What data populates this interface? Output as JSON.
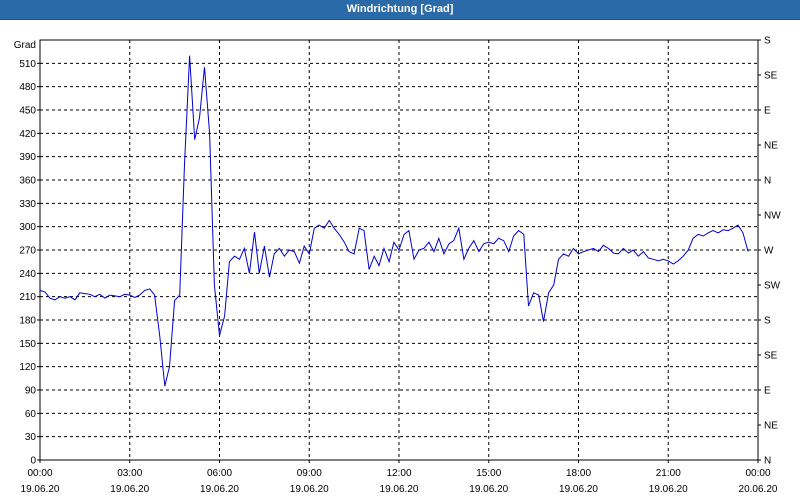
{
  "window": {
    "title": "Windrichtung [Grad]"
  },
  "chart_data": {
    "type": "line",
    "title": "Windrichtung [Grad]",
    "ylabel": "Grad",
    "xlabel": "",
    "ylim": [
      0,
      540
    ],
    "xlim": [
      0,
      24
    ],
    "grid": true,
    "yticks": [
      0,
      30,
      60,
      90,
      120,
      150,
      180,
      210,
      240,
      270,
      300,
      330,
      360,
      390,
      420,
      450,
      480,
      510
    ],
    "right_axis": {
      "ticks": [
        0,
        45,
        90,
        135,
        180,
        225,
        270,
        315,
        360,
        405,
        450,
        495,
        540
      ],
      "labels": [
        "N",
        "NE",
        "E",
        "SE",
        "S",
        "SW",
        "W",
        "NW",
        "N",
        "NE",
        "E",
        "SE",
        "S"
      ]
    },
    "xticks": [
      {
        "x": 0,
        "time": "00:00",
        "date": "19.06.20"
      },
      {
        "x": 3,
        "time": "03:00",
        "date": "19.06.20"
      },
      {
        "x": 6,
        "time": "06:00",
        "date": "19.06.20"
      },
      {
        "x": 9,
        "time": "09:00",
        "date": "19.06.20"
      },
      {
        "x": 12,
        "time": "12:00",
        "date": "19.06.20"
      },
      {
        "x": 15,
        "time": "15:00",
        "date": "19.06.20"
      },
      {
        "x": 18,
        "time": "18:00",
        "date": "19.06.20"
      },
      {
        "x": 21,
        "time": "21:00",
        "date": "19.06.20"
      },
      {
        "x": 24,
        "time": "00:00",
        "date": "20.06.20"
      }
    ],
    "series": [
      {
        "color": "#0000cc",
        "points": [
          [
            0.0,
            218
          ],
          [
            0.17,
            216
          ],
          [
            0.33,
            208
          ],
          [
            0.5,
            206
          ],
          [
            0.67,
            210
          ],
          [
            0.83,
            208
          ],
          [
            1.0,
            210
          ],
          [
            1.17,
            206
          ],
          [
            1.33,
            215
          ],
          [
            1.5,
            214
          ],
          [
            1.67,
            213
          ],
          [
            1.83,
            210
          ],
          [
            2.0,
            213
          ],
          [
            2.17,
            208
          ],
          [
            2.33,
            212
          ],
          [
            2.5,
            211
          ],
          [
            2.67,
            210
          ],
          [
            2.83,
            213
          ],
          [
            3.0,
            212
          ],
          [
            3.17,
            209
          ],
          [
            3.33,
            212
          ],
          [
            3.5,
            218
          ],
          [
            3.67,
            220
          ],
          [
            3.83,
            212
          ],
          [
            4.0,
            160
          ],
          [
            4.17,
            95
          ],
          [
            4.33,
            120
          ],
          [
            4.5,
            205
          ],
          [
            4.67,
            212
          ],
          [
            4.83,
            380
          ],
          [
            5.0,
            520
          ],
          [
            5.17,
            412
          ],
          [
            5.33,
            440
          ],
          [
            5.5,
            505
          ],
          [
            5.67,
            420
          ],
          [
            5.83,
            225
          ],
          [
            6.0,
            160
          ],
          [
            6.17,
            185
          ],
          [
            6.33,
            255
          ],
          [
            6.5,
            262
          ],
          [
            6.67,
            258
          ],
          [
            6.83,
            272
          ],
          [
            7.0,
            240
          ],
          [
            7.17,
            293
          ],
          [
            7.33,
            240
          ],
          [
            7.5,
            275
          ],
          [
            7.67,
            235
          ],
          [
            7.83,
            265
          ],
          [
            8.0,
            272
          ],
          [
            8.17,
            262
          ],
          [
            8.33,
            270
          ],
          [
            8.5,
            268
          ],
          [
            8.67,
            253
          ],
          [
            8.83,
            275
          ],
          [
            9.0,
            265
          ],
          [
            9.17,
            298
          ],
          [
            9.33,
            302
          ],
          [
            9.5,
            298
          ],
          [
            9.67,
            308
          ],
          [
            9.83,
            298
          ],
          [
            10.0,
            290
          ],
          [
            10.17,
            280
          ],
          [
            10.33,
            268
          ],
          [
            10.5,
            265
          ],
          [
            10.67,
            298
          ],
          [
            10.83,
            295
          ],
          [
            11.0,
            245
          ],
          [
            11.17,
            262
          ],
          [
            11.33,
            250
          ],
          [
            11.5,
            272
          ],
          [
            11.67,
            255
          ],
          [
            11.83,
            280
          ],
          [
            12.0,
            270
          ],
          [
            12.17,
            290
          ],
          [
            12.33,
            295
          ],
          [
            12.5,
            258
          ],
          [
            12.67,
            270
          ],
          [
            12.83,
            272
          ],
          [
            13.0,
            280
          ],
          [
            13.17,
            268
          ],
          [
            13.33,
            285
          ],
          [
            13.5,
            265
          ],
          [
            13.67,
            278
          ],
          [
            13.83,
            282
          ],
          [
            14.0,
            298
          ],
          [
            14.17,
            258
          ],
          [
            14.33,
            272
          ],
          [
            14.5,
            282
          ],
          [
            14.67,
            268
          ],
          [
            14.83,
            278
          ],
          [
            15.0,
            280
          ],
          [
            15.17,
            278
          ],
          [
            15.33,
            285
          ],
          [
            15.5,
            282
          ],
          [
            15.67,
            268
          ],
          [
            15.83,
            288
          ],
          [
            16.0,
            295
          ],
          [
            16.17,
            290
          ],
          [
            16.33,
            198
          ],
          [
            16.5,
            215
          ],
          [
            16.67,
            212
          ],
          [
            16.83,
            178
          ],
          [
            17.0,
            215
          ],
          [
            17.17,
            225
          ],
          [
            17.33,
            258
          ],
          [
            17.5,
            265
          ],
          [
            17.67,
            262
          ],
          [
            17.83,
            272
          ],
          [
            18.0,
            265
          ],
          [
            18.17,
            268
          ],
          [
            18.33,
            270
          ],
          [
            18.5,
            272
          ],
          [
            18.67,
            268
          ],
          [
            18.83,
            276
          ],
          [
            19.0,
            272
          ],
          [
            19.17,
            266
          ],
          [
            19.33,
            265
          ],
          [
            19.5,
            272
          ],
          [
            19.67,
            266
          ],
          [
            19.83,
            270
          ],
          [
            20.0,
            262
          ],
          [
            20.17,
            268
          ],
          [
            20.33,
            260
          ],
          [
            20.5,
            258
          ],
          [
            20.67,
            256
          ],
          [
            20.83,
            258
          ],
          [
            21.0,
            256
          ],
          [
            21.17,
            252
          ],
          [
            21.33,
            256
          ],
          [
            21.5,
            262
          ],
          [
            21.67,
            270
          ],
          [
            21.83,
            285
          ],
          [
            22.0,
            290
          ],
          [
            22.17,
            288
          ],
          [
            22.33,
            292
          ],
          [
            22.5,
            295
          ],
          [
            22.67,
            292
          ],
          [
            22.83,
            296
          ],
          [
            23.0,
            295
          ],
          [
            23.17,
            298
          ],
          [
            23.33,
            302
          ],
          [
            23.5,
            292
          ],
          [
            23.67,
            268
          ]
        ]
      }
    ]
  }
}
